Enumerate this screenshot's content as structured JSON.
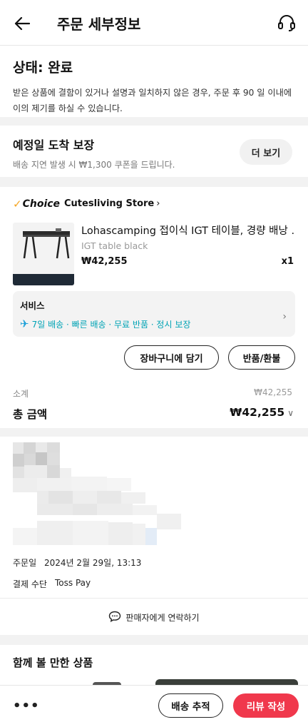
{
  "header": {
    "title": "주문 세부정보"
  },
  "status": {
    "title": "상태: 완료",
    "description_line1": "받은 상품에 결함이 있거나 설명과 일치하지 않은 경우, 주문 후 90 일 이내에",
    "description_line2": "이의 제기를 하실 수 있습니다."
  },
  "guarantee": {
    "title": "예정일 도착 보장",
    "description": "배송 지연 발생 시 ₩1,300 쿠폰을 드립니다.",
    "more_label": "더 보기"
  },
  "order": {
    "badge": "Choice",
    "store_name": "Cutesliving Store",
    "product": {
      "title": "Lohascamping 접이식 IGT 테이블, 경량 배낭 ...",
      "variant": "IGT table black",
      "price": "₩42,255",
      "quantity": "x1"
    },
    "service": {
      "title": "서비스",
      "line": "7일 배송 · 빠른 배송 · 무료 반품 · 정시 보장"
    },
    "cart_button": "장바구니에 담기",
    "return_button": "반품/환불",
    "subtotal_label": "소계",
    "subtotal_value": "₩42,255",
    "total_label": "총 금액",
    "total_value": "₩42,255"
  },
  "info": {
    "order_date_label": "주문일",
    "order_date_value": "2024년 2월 29일, 13:13",
    "payment_label": "결제 수단",
    "payment_value": "Toss Pay",
    "contact_label": "판매자에게 연락하기"
  },
  "recommend": {
    "title": "함께 볼 만한 상품"
  },
  "bottom": {
    "more_dots": "•••",
    "track_label": "배송 추적",
    "review_label": "리뷰 작성"
  },
  "colors": {
    "accent_red": "#f0384c",
    "service_teal": "#00a3b5",
    "choice_gold": "#f5a623"
  },
  "icons": [
    "back-arrow-icon",
    "customer-service-headset-icon",
    "checkmark-icon",
    "chevron-right-icon",
    "airplane-icon",
    "chevron-down-icon",
    "chat-bubble-icon"
  ]
}
